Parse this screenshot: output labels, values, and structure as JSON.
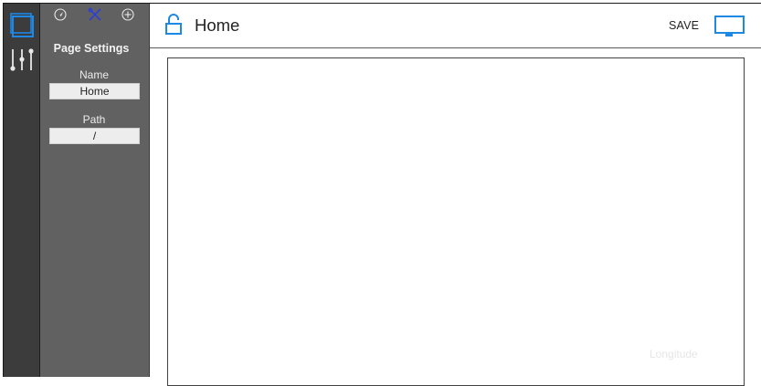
{
  "rail": {
    "items": [
      {
        "name": "pages-icon",
        "active": true
      },
      {
        "name": "sliders-icon",
        "active": false
      }
    ]
  },
  "panel": {
    "toolbar": [
      {
        "name": "navigate-icon"
      },
      {
        "name": "tools-icon",
        "active": true
      },
      {
        "name": "add-icon"
      }
    ],
    "title": "Page Settings",
    "name_label": "Name",
    "name_value": "Home",
    "path_label": "Path",
    "path_value": "/"
  },
  "header": {
    "title": "Home",
    "save_label": "SAVE",
    "lock_icon": "unlocked-lock-icon",
    "device_icon": "monitor-icon"
  },
  "canvas": {
    "ghost_label": "Longitude"
  },
  "colors": {
    "accent": "#1e88e5",
    "rail_bg": "#3c3c3c",
    "panel_bg": "#616161",
    "tool_active": "#2f3fd6"
  }
}
